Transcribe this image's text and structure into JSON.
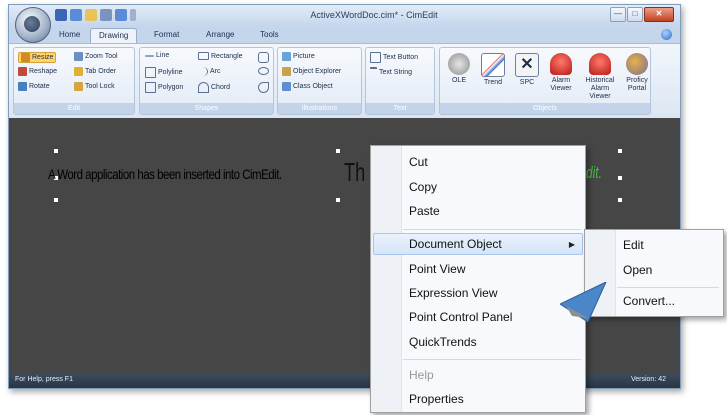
{
  "window": {
    "title": "ActiveXWordDoc.cim* - CimEdit",
    "controls": {
      "minimize": "—",
      "maximize": "□",
      "close": "✕"
    }
  },
  "tabs": [
    "Home",
    "Drawing",
    "Format",
    "Arrange",
    "Tools"
  ],
  "active_tab": "Drawing",
  "ribbon": {
    "edit": {
      "label": "Edit",
      "items": [
        "Resize",
        "Zoom Tool",
        "Reshape",
        "Tab Order",
        "Rotate",
        "Tool Lock"
      ]
    },
    "shapes": {
      "label": "Shapes",
      "items": [
        "Line",
        "Rectangle",
        "Polyline",
        "Arc",
        "Polygon",
        "Chord"
      ]
    },
    "illustrations": {
      "label": "Illustrations",
      "items": [
        "Picture",
        "Object Explorer",
        "Class Object"
      ]
    },
    "text": {
      "label": "Text",
      "items": [
        "Text Button",
        "Text String"
      ]
    },
    "objects": {
      "label": "Objects",
      "items": [
        "OLE",
        "Trend",
        "SPC",
        "Alarm\nViewer",
        "Historical\nAlarm Viewer",
        "Proficy\nPortal"
      ]
    }
  },
  "document": {
    "text": "A Word application has been inserted into CimEdit.",
    "large_text": "Th",
    "green_text": "dit."
  },
  "status": {
    "left": "For Help, press F1",
    "right": "Version: 42"
  },
  "context_menu": {
    "items": [
      "Cut",
      "Copy",
      "Paste",
      "Document Object",
      "Point View",
      "Expression View",
      "Point Control Panel",
      "QuickTrends",
      "Help",
      "Properties"
    ],
    "highlighted": "Document Object"
  },
  "submenu": {
    "items": [
      "Edit",
      "Open",
      "Convert..."
    ]
  },
  "colors": {
    "canvas": "#464646",
    "ribbon_group_label": "#c3d4ea",
    "menu_highlight": "#d5e5f8",
    "pointer": "#4a86c8"
  }
}
